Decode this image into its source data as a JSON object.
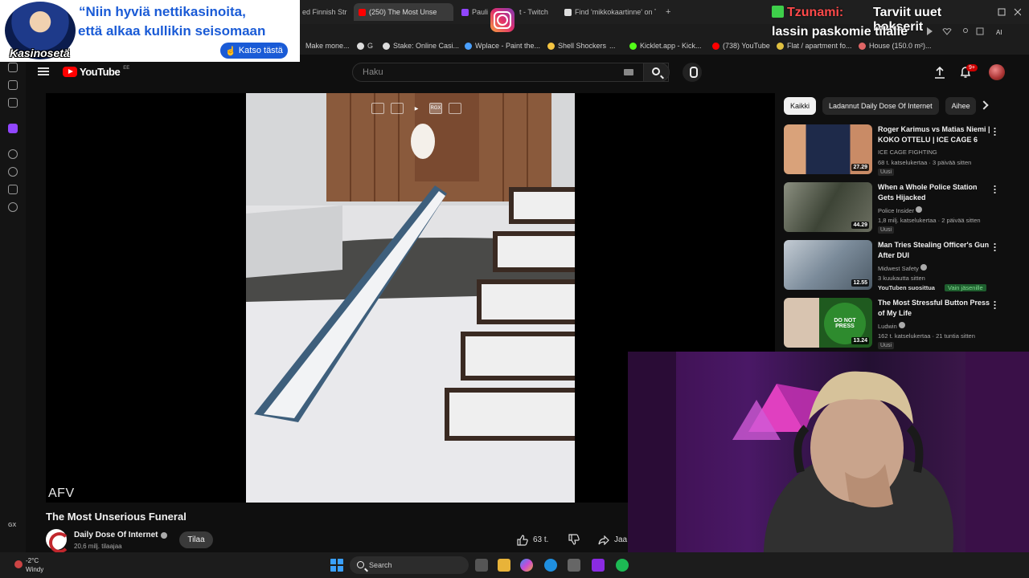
{
  "browser": {
    "tabs": [
      {
        "label": "ed Finnish Str",
        "color": "#7b2ff7"
      },
      {
        "label": "(250) The Most Unse",
        "color": "#ff0000",
        "active": true
      },
      {
        "label": "Pauli",
        "color": "#9146ff"
      },
      {
        "label": "t - Twitch",
        "color": "#9146ff"
      },
      {
        "label": "Find 'mikkokaartinne' on T",
        "color": "#ddd"
      }
    ],
    "bookmarks": [
      {
        "label": "Make mone...",
        "color": "#777"
      },
      {
        "label": "G",
        "color": "#ddd"
      },
      {
        "label": "Stake: Online Casi...",
        "color": "#ddd"
      },
      {
        "label": "Wplace - Paint the...",
        "color": "#4aa0ff"
      },
      {
        "label": "Shell Shockers",
        "color": "#f5c542"
      },
      {
        "label": "...",
        "color": "#1c1c1c"
      },
      {
        "label": "Kicklet.app - Kick...",
        "color": "#53fc18"
      },
      {
        "label": "(738) YouTube",
        "color": "#ff0000"
      },
      {
        "label": "Flat / apartment fo...",
        "color": "#e0c040"
      },
      {
        "label": "House (150.0 m²)...",
        "color": "#e06666"
      }
    ],
    "sidebar_bottom_label": "GX"
  },
  "youtube": {
    "logo_text": "YouTube",
    "country_code": "EE",
    "search_placeholder": "Haku",
    "notification_count": "9+",
    "video": {
      "watermark": "AFV",
      "title": "The Most Unserious Funeral",
      "channel": "Daily Dose Of Internet",
      "subscribers": "20,6 milj. tilaajaa",
      "subscribe_label": "Tilaa",
      "likes": "63 t.",
      "share_label": "Jaa",
      "overlay_quality": "RGX"
    },
    "chips": [
      "Kaikki",
      "Ladannut Daily Dose Of Internet",
      "Aihee"
    ],
    "recommendations": [
      {
        "title": "Roger Karimus vs Matias Niemi | KOKO OTTELU | ICE CAGE 6",
        "channel": "ICE CAGE FIGHTING",
        "meta": "68 t. katselukertaa · 3 päivää sitten",
        "badge": "Uusi",
        "duration": "27.29",
        "thumb_color": "#3a3a52"
      },
      {
        "title": "When a Whole Police Station Gets Hijacked",
        "channel": "Police Insider",
        "meta": "1,8 milj. katselukertaa · 2 päivää sitten",
        "badge": "Uusi",
        "duration": "44.29",
        "thumb_color": "#4c5448"
      },
      {
        "title": "Man Tries Stealing Officer's Gun After DUI",
        "channel": "Midwest Safety",
        "meta": "3 kuukautta sitten",
        "badge": "YouTuben suosittua",
        "badge2": "Vain jäsenille",
        "duration": "12.55",
        "thumb_color": "#7a8a99"
      },
      {
        "title": "The Most Stressful Button Press of My Life",
        "channel": "Ludwin",
        "meta": "162 t. katselukertaa · 21 tuntia sitten",
        "badge": "Uusi",
        "duration": "13.24",
        "thumb_color": "#2d6e2d",
        "thumb_text": "DO NOT PRESS"
      }
    ]
  },
  "overlays": {
    "ad": {
      "line1": "“Niin hyviä nettikasinoita,",
      "line2": "että alkaa kullikin seisomaan",
      "brand": "Kasinosetä",
      "cta": "Katso tästä"
    },
    "alert": {
      "user": "Tzunami:",
      "message_line1": "Tarviit uuet bokserit",
      "message_line2": "lassin paskomie tilalle"
    }
  },
  "taskbar": {
    "weather_temp": "-2°C",
    "weather_desc": "Windy",
    "search_label": "Search"
  }
}
